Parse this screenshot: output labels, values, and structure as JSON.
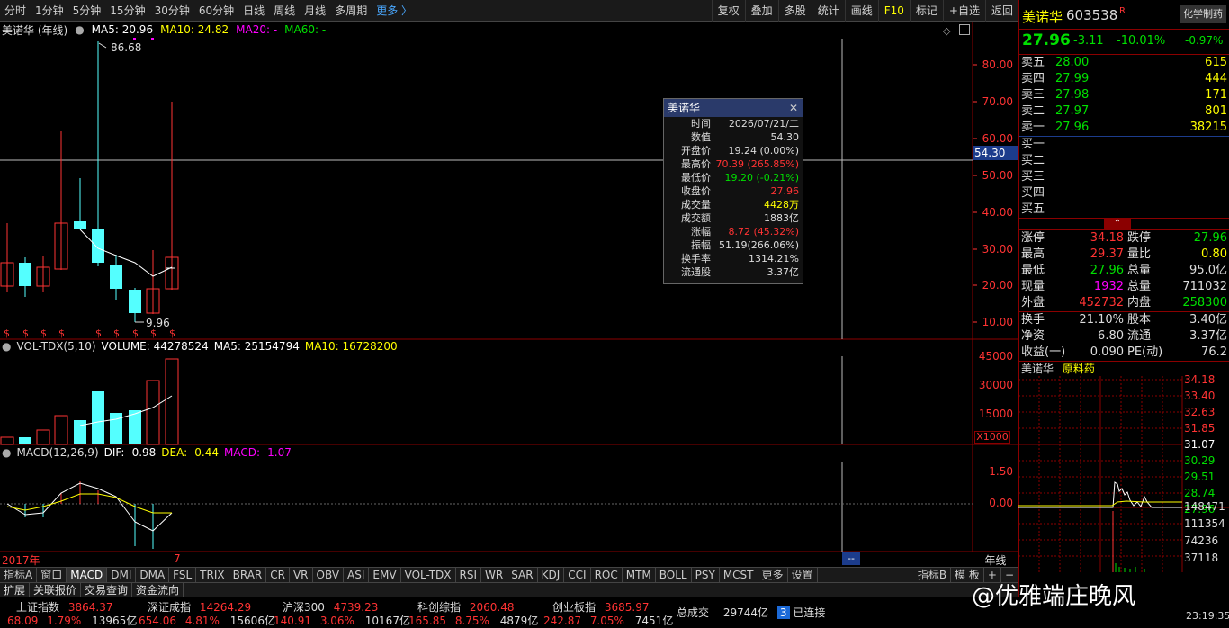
{
  "toolbar": {
    "left": [
      "分时",
      "1分钟",
      "5分钟",
      "15分钟",
      "30分钟",
      "60分钟",
      "日线",
      "周线",
      "月线",
      "多周期"
    ],
    "more": "更多 〉",
    "right": [
      "复权",
      "叠加",
      "多股",
      "统计",
      "画线",
      "F10",
      "标记",
      "+自选",
      "返回"
    ]
  },
  "kline": {
    "name": "美诺华 (年线)",
    "ma5": "MA5: 20.96",
    "ma10": "MA10: 24.82",
    "ma20": "MA20: -",
    "ma60": "MA60: -",
    "y_labels": [
      "80.00",
      "70.00",
      "60.00",
      "50.00",
      "40.00",
      "30.00",
      "20.00",
      "10.00"
    ],
    "high_mark": "86.68",
    "low_mark": "9.96",
    "cursor_price": "54.30"
  },
  "volume": {
    "header": "VOL-TDX(5,10)",
    "volume": "VOLUME: 44278524",
    "ma5": "MA5: 25154794",
    "ma10": "MA10: 16728200",
    "y_labels": [
      "45000",
      "30000",
      "15000"
    ],
    "unit": "X1000"
  },
  "macd": {
    "header": "MACD(12,26,9)",
    "dif": "DIF: -0.98",
    "dea": "DEA: -0.44",
    "macd": "MACD: -1.07",
    "y_labels": [
      "1.50",
      "0.00"
    ]
  },
  "xaxis": {
    "start": "2017年",
    "mark": "7",
    "period": "年线",
    "cursor": "--"
  },
  "tooltip": {
    "title": "美诺华",
    "rows": [
      {
        "k": "时间",
        "v": "2026/07/21/二",
        "c": "#ddd"
      },
      {
        "k": "数值",
        "v": "54.30",
        "c": "#ddd"
      },
      {
        "k": "开盘价",
        "v": "19.24 (0.00%)",
        "c": "#ddd"
      },
      {
        "k": "最高价",
        "v": "70.39 (265.85%)",
        "c": "#ff3333"
      },
      {
        "k": "最低价",
        "v": "19.20 (-0.21%)",
        "c": "#00e000"
      },
      {
        "k": "收盘价",
        "v": "27.96",
        "c": "#ff3333"
      },
      {
        "k": "成交量",
        "v": "4428万",
        "c": "#ffff00"
      },
      {
        "k": "成交额",
        "v": "1883亿",
        "c": "#ddd"
      },
      {
        "k": "涨幅",
        "v": "8.72 (45.32%)",
        "c": "#ff3333"
      },
      {
        "k": "振幅",
        "v": "51.19(266.06%)",
        "c": "#ddd"
      },
      {
        "k": "换手率",
        "v": "1314.21%",
        "c": "#ddd"
      },
      {
        "k": "流通股",
        "v": "3.37亿",
        "c": "#ddd"
      }
    ]
  },
  "indicator_tabs": [
    "指标A",
    "窗口",
    "MACD",
    "DMI",
    "DMA",
    "FSL",
    "TRIX",
    "BRAR",
    "CR",
    "VR",
    "OBV",
    "ASI",
    "EMV",
    "VOL-TDX",
    "RSI",
    "WR",
    "SAR",
    "KDJ",
    "CCI",
    "ROC",
    "MTM",
    "BOLL",
    "PSY",
    "MCST",
    "更多",
    "设置"
  ],
  "indicator_right": [
    "指标B",
    "模 板",
    "+",
    "−"
  ],
  "bottom_tabs": [
    "扩展",
    "关联报价",
    "交易查询",
    "资金流向"
  ],
  "quote": {
    "name": "美诺华",
    "code": "603538",
    "flag": "R",
    "sector": "化学制药",
    "sector_pct": "-0.97%",
    "price": "27.96",
    "change": "-3.11",
    "pct": "-10.01%",
    "asks": [
      {
        "label": "卖五",
        "price": "28.00",
        "vol": "615"
      },
      {
        "label": "卖四",
        "price": "27.99",
        "vol": "444"
      },
      {
        "label": "卖三",
        "price": "27.98",
        "vol": "171"
      },
      {
        "label": "卖二",
        "price": "27.97",
        "vol": "801"
      },
      {
        "label": "卖一",
        "price": "27.96",
        "vol": "38215"
      }
    ],
    "bids": [
      "买一",
      "买二",
      "买三",
      "买四",
      "买五"
    ],
    "stats": [
      {
        "k1": "涨停",
        "v1": "34.18",
        "c1": "#ff3333",
        "k2": "跌停",
        "v2": "27.96",
        "c2": "#00e000"
      },
      {
        "k1": "最高",
        "v1": "29.37",
        "c1": "#ff3333",
        "k2": "量比",
        "v2": "0.80",
        "c2": "#ffff00"
      },
      {
        "k1": "最低",
        "v1": "27.96",
        "c1": "#00e000",
        "k2": "总量",
        "v2": "95.0亿",
        "c2": "#ddd"
      },
      {
        "k1": "现量",
        "v1": "1932",
        "c1": "#ff00ff",
        "k2": "总量",
        "v2": "711032",
        "c2": "#ddd"
      },
      {
        "k1": "外盘",
        "v1": "452732",
        "c1": "#ff3333",
        "k2": "内盘",
        "v2": "258300",
        "c2": "#00e000"
      }
    ],
    "stats2": [
      {
        "k1": "换手",
        "v1": "21.10%",
        "k2": "股本",
        "v2": "3.40亿"
      },
      {
        "k1": "净资",
        "v1": "6.80",
        "k2": "流通",
        "v2": "3.37亿"
      },
      {
        "k1": "收益(一)",
        "v1": "0.090",
        "k2": "PE(动)",
        "v2": "76.2"
      }
    ],
    "mini_title": "美诺华",
    "mini_sub": "原料药",
    "mini_prices": [
      "34.18",
      "33.40",
      "32.63",
      "31.85",
      "31.07",
      "30.29",
      "29.51",
      "28.74",
      "27.96"
    ],
    "mini_vols": [
      "148471",
      "111354",
      "74236",
      "37118"
    ]
  },
  "ticker": [
    {
      "name": "上证指数",
      "val": "3864.37",
      "pct": "1.79%",
      "chg": "68.09",
      "amt": "13965亿"
    },
    {
      "name": "深证成指",
      "val": "14264.29",
      "pct": "4.81%",
      "chg": "654.06",
      "amt": "15606亿"
    },
    {
      "name": "沪深300",
      "val": "4739.23",
      "pct": "3.06%",
      "chg": "140.91",
      "amt": "10167亿"
    },
    {
      "name": "科创综指",
      "val": "2060.48",
      "pct": "8.75%",
      "chg": "165.85",
      "amt": "4879亿"
    },
    {
      "name": "创业板指",
      "val": "3685.97",
      "pct": "7.05%",
      "chg": "242.87",
      "amt": "7451亿"
    }
  ],
  "total": {
    "label": "总成交",
    "val": "29744亿",
    "conn": "3",
    "conn_label": "已连接",
    "time": "23:19:35"
  },
  "watermark": "@优雅端庄晚风"
}
